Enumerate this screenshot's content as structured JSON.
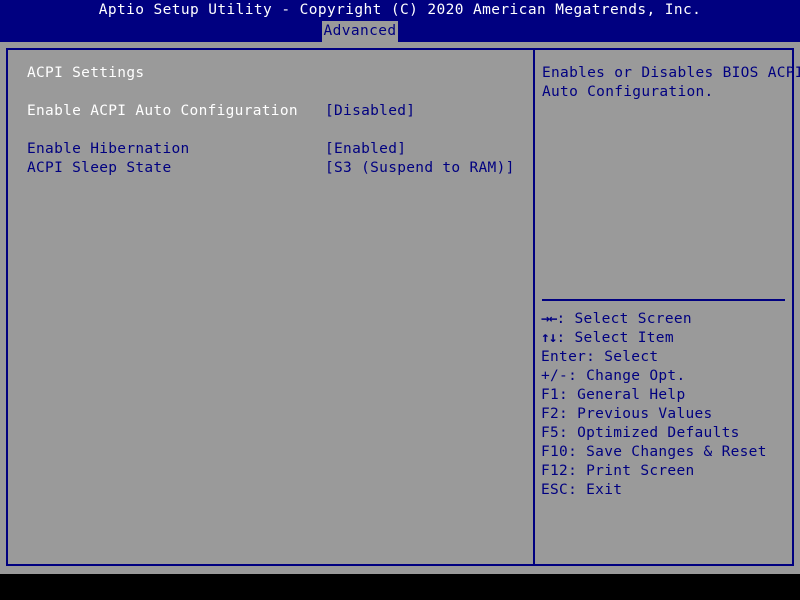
{
  "titlebar": {
    "text": "Aptio Setup Utility - Copyright (C) 2020 American Megatrends, Inc."
  },
  "menubar": {
    "active_tab": "Advanced"
  },
  "settings": {
    "section_title": "ACPI Settings",
    "items": [
      {
        "label": "Enable ACPI Auto Configuration",
        "value": "[Disabled]",
        "selected": true
      },
      {
        "label": "Enable Hibernation",
        "value": "[Enabled]",
        "selected": false
      },
      {
        "label": "ACPI Sleep State",
        "value": "[S3 (Suspend to RAM)]",
        "selected": false
      }
    ]
  },
  "help": {
    "description_lines": [
      "Enables or Disables BIOS ACPI",
      "Auto Configuration."
    ],
    "keys": [
      {
        "glyph": "→←",
        "text": ": Select Screen"
      },
      {
        "glyph": "↑↓",
        "text": ": Select Item"
      },
      {
        "glyph": "",
        "text": "Enter: Select"
      },
      {
        "glyph": "",
        "text": "+/-: Change Opt."
      },
      {
        "glyph": "",
        "text": "F1: General Help"
      },
      {
        "glyph": "",
        "text": "F2: Previous Values"
      },
      {
        "glyph": "",
        "text": "F5: Optimized Defaults"
      },
      {
        "glyph": "",
        "text": "F10: Save Changes & Reset"
      },
      {
        "glyph": "",
        "text": "F12: Print Screen"
      },
      {
        "glyph": "",
        "text": "ESC: Exit"
      }
    ]
  },
  "colors": {
    "background_gray": "#9a9a9a",
    "accent_blue": "#000080",
    "selected_text": "#ffffff",
    "bottom_bar": "#000000"
  }
}
